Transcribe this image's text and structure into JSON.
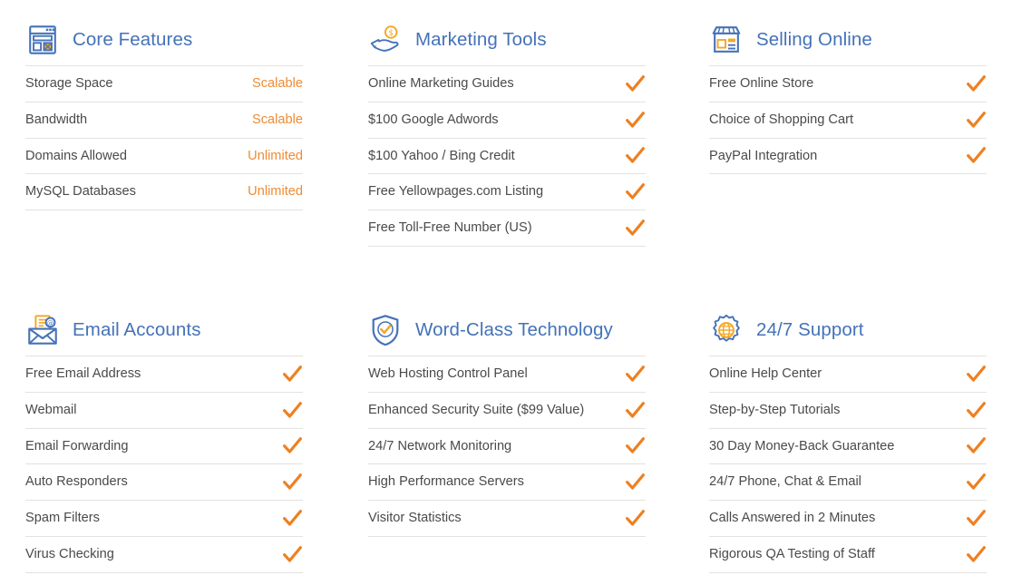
{
  "colors": {
    "heading_blue": "#4472b8",
    "accent_orange": "#ef8b33",
    "check_orange": "#ee8020",
    "label_gray": "#4a4a4a",
    "divider": "#e2e2e2",
    "background": "#ffffff"
  },
  "columns": [
    {
      "id": "core-features",
      "title": "Core Features",
      "icon": "browser-window-icon",
      "value_type": "text",
      "rows": [
        {
          "label": "Storage Space",
          "value": "Scalable"
        },
        {
          "label": "Bandwidth",
          "value": "Scalable"
        },
        {
          "label": "Domains Allowed",
          "value": "Unlimited"
        },
        {
          "label": "MySQL Databases",
          "value": "Unlimited"
        }
      ]
    },
    {
      "id": "marketing-tools",
      "title": "Marketing Tools",
      "icon": "hand-holding-coin-icon",
      "value_type": "check",
      "rows": [
        {
          "label": "Online Marketing Guides",
          "value": "check"
        },
        {
          "label": "$100 Google Adwords",
          "value": "check"
        },
        {
          "label": "$100 Yahoo / Bing Credit",
          "value": "check"
        },
        {
          "label": "Free Yellowpages.com Listing",
          "value": "check"
        },
        {
          "label": "Free Toll-Free Number (US)",
          "value": "check"
        }
      ]
    },
    {
      "id": "selling-online",
      "title": "Selling Online",
      "icon": "storefront-icon",
      "value_type": "check",
      "rows": [
        {
          "label": "Free Online Store",
          "value": "check"
        },
        {
          "label": "Choice of Shopping Cart",
          "value": "check"
        },
        {
          "label": "PayPal Integration",
          "value": "check"
        }
      ]
    },
    {
      "id": "email-accounts",
      "title": "Email Accounts",
      "icon": "envelope-at-icon",
      "value_type": "check",
      "rows": [
        {
          "label": "Free Email Address",
          "value": "check"
        },
        {
          "label": "Webmail",
          "value": "check"
        },
        {
          "label": "Email Forwarding",
          "value": "check"
        },
        {
          "label": "Auto Responders",
          "value": "check"
        },
        {
          "label": "Spam Filters",
          "value": "check"
        },
        {
          "label": "Virus Checking",
          "value": "check"
        }
      ]
    },
    {
      "id": "word-class-technology",
      "title": "Word-Class Technology",
      "icon": "shield-check-icon",
      "value_type": "check",
      "rows": [
        {
          "label": "Web Hosting Control Panel",
          "value": "check"
        },
        {
          "label": "Enhanced Security Suite ($99 Value)",
          "value": "check"
        },
        {
          "label": "24/7 Network Monitoring",
          "value": "check"
        },
        {
          "label": "High Performance Servers",
          "value": "check"
        },
        {
          "label": "Visitor Statistics",
          "value": "check"
        }
      ]
    },
    {
      "id": "support-247",
      "title": "24/7 Support",
      "icon": "gear-globe-icon",
      "value_type": "check",
      "rows": [
        {
          "label": "Online Help Center",
          "value": "check"
        },
        {
          "label": "Step-by-Step Tutorials",
          "value": "check"
        },
        {
          "label": "30 Day Money-Back Guarantee",
          "value": "check"
        },
        {
          "label": "24/7 Phone, Chat & Email",
          "value": "check"
        },
        {
          "label": "Calls Answered in 2 Minutes",
          "value": "check"
        },
        {
          "label": "Rigorous QA Testing of Staff",
          "value": "check"
        }
      ]
    }
  ]
}
